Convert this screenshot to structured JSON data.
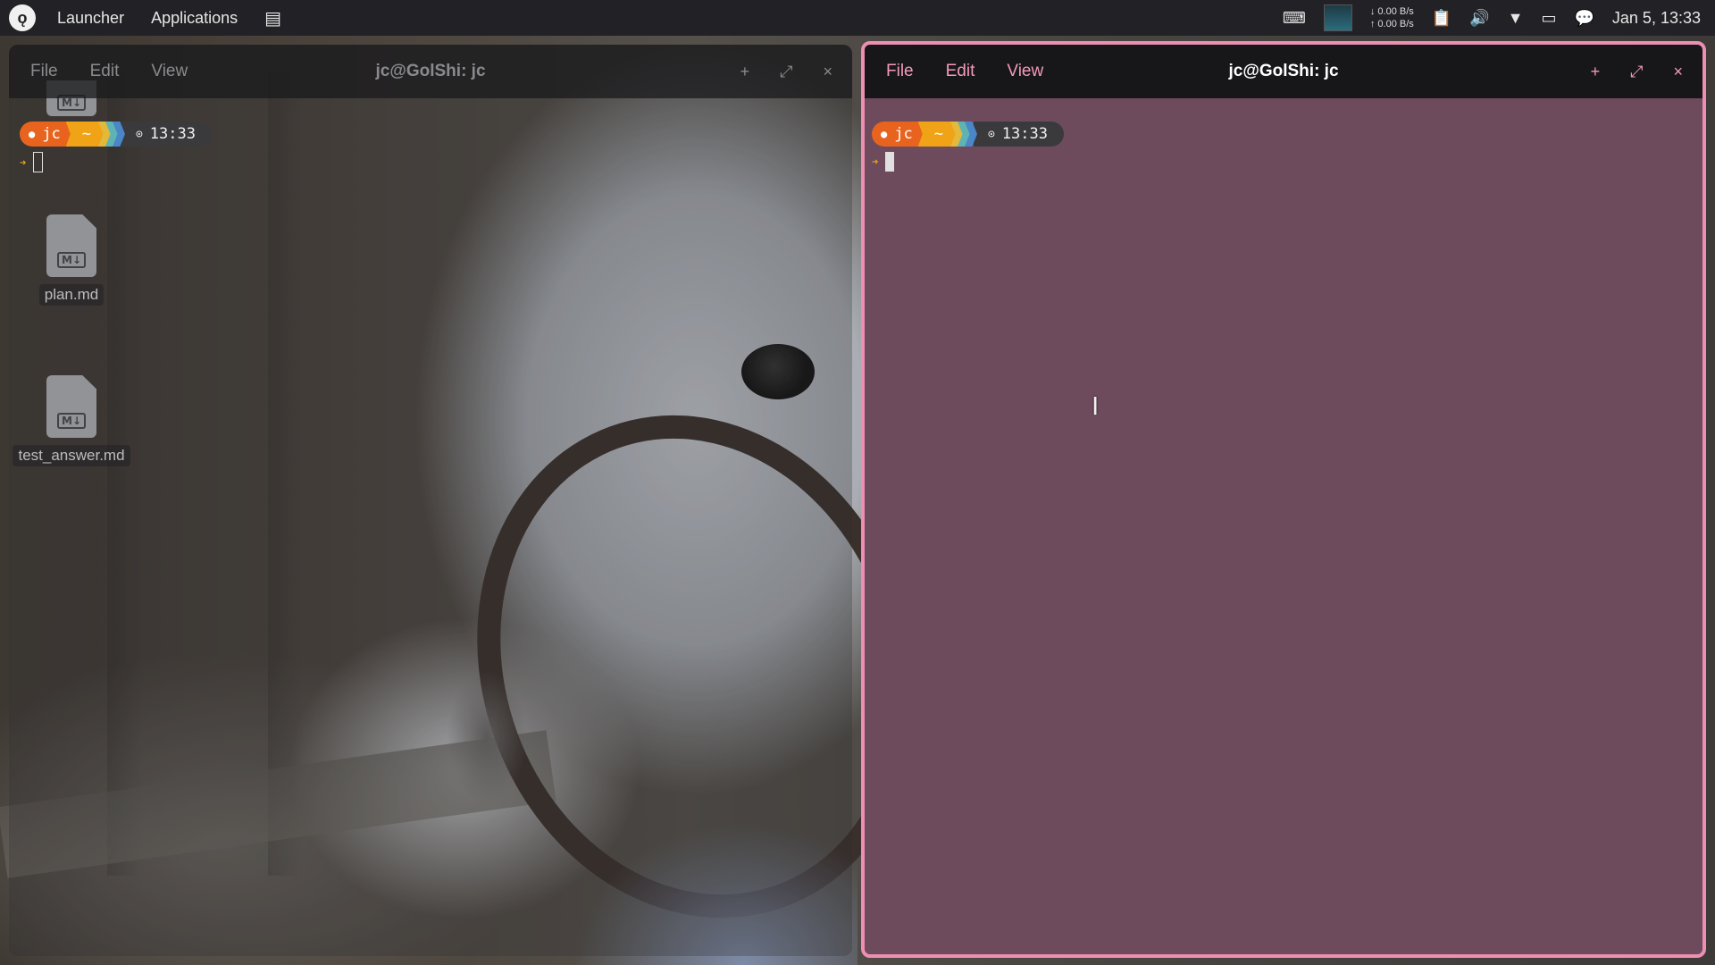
{
  "topbar": {
    "launcher_label": "Launcher",
    "applications_label": "Applications",
    "net_down": "↓ 0.00 B/s",
    "net_up": "↑ 0.00 B/s",
    "clock": "Jan 5, 13:33"
  },
  "desktop": {
    "files": [
      {
        "name": "plan.md",
        "badge": "M↓"
      },
      {
        "name": "test_answer.md",
        "badge": "M↓"
      }
    ],
    "partial_badge": "M↓"
  },
  "terminal_left": {
    "menu": {
      "file": "File",
      "edit": "Edit",
      "view": "View"
    },
    "title": "jc@GolShi: jc",
    "prompt": {
      "user": "jc",
      "dir": "~",
      "time": "13:33"
    },
    "controls": {
      "new": "+",
      "maximize": "⤢",
      "close": "×"
    }
  },
  "terminal_right": {
    "menu": {
      "file": "File",
      "edit": "Edit",
      "view": "View"
    },
    "title": "jc@GolShi: jc",
    "prompt": {
      "user": "jc",
      "dir": "~",
      "time": "13:33"
    },
    "controls": {
      "new": "+",
      "maximize": "⤢",
      "close": "×"
    }
  },
  "colors": {
    "accent_pink": "#ec8fb2",
    "terminal_bg": "#6e4b5c",
    "prompt_user": "#e8641e",
    "prompt_dir": "#f0a316"
  }
}
